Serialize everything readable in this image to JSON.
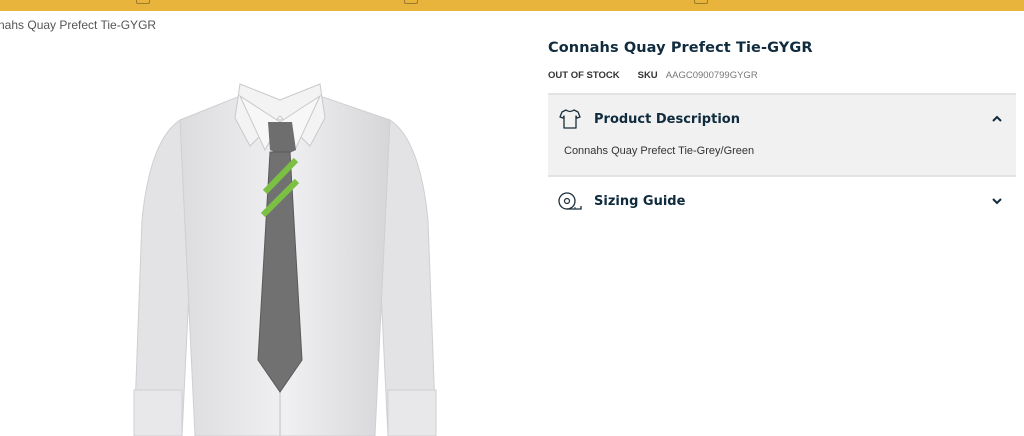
{
  "colors": {
    "accent_bar": "#e8b43c",
    "heading": "#0f2b3d"
  },
  "breadcrumb": {
    "current": "nahs Quay Prefect Tie-GYGR"
  },
  "product": {
    "title": "Connahs Quay Prefect Tie-GYGR",
    "stock_status": "OUT OF STOCK",
    "sku_label": "SKU",
    "sku_value": "AAGC0900799GYGR",
    "image_icon": "shirt-with-tie-image"
  },
  "accordion": [
    {
      "title": "Product Description",
      "icon": "tshirt-icon",
      "expanded": true,
      "body": "Connahs Quay Prefect Tie-Grey/Green"
    },
    {
      "title": "Sizing Guide",
      "icon": "measuring-tape-icon",
      "expanded": false
    }
  ]
}
